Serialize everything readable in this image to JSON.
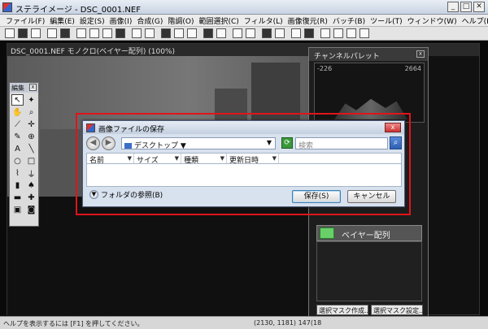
{
  "window": {
    "title": "ステライメージ - DSC_0001.NEF",
    "buttons": {
      "minimize": "_",
      "maximize": "□",
      "close": "✕"
    }
  },
  "menu": [
    "ファイル(F)",
    "編集(E)",
    "設定(S)",
    "画像(I)",
    "合成(G)",
    "階調(O)",
    "範囲選択(C)",
    "フィルタ(L)",
    "画像復元(R)",
    "バッチ(B)",
    "ツール(T)",
    "ウィンドウ(W)",
    "ヘルプ(H)"
  ],
  "document": {
    "title": "DSC_0001.NEF モノクロ(ベイヤー配列) (100%)"
  },
  "edit_palette": {
    "title": "編集",
    "close": "x"
  },
  "channel_palette": {
    "title": "チャンネルパレット",
    "close": "x",
    "histogram": {
      "min": "-226",
      "max": "2664"
    },
    "bayer_label": "ベイヤー配列",
    "button1": "選択マスク作成...",
    "button2": "選択マスク設定..."
  },
  "dialog": {
    "title": "画像ファイルの保存",
    "close": "x",
    "back": "◀",
    "forward": "▶",
    "location": "デスクトップ",
    "location_caret": "▼",
    "dropdown_caret": "▼",
    "search_placeholder": "検索",
    "columns": [
      "名前",
      "サイズ",
      "種類",
      "更新日時"
    ],
    "column_caret": "▼",
    "browse_label": "フォルダの参照(B)",
    "browse_arrow": "▼",
    "save_button": "保存(S)",
    "cancel_button": "キャンセル"
  },
  "status": {
    "help_text": "ヘルプを表示するには [F1] を押してください。",
    "coords": "(2130, 1181) 147(18"
  }
}
